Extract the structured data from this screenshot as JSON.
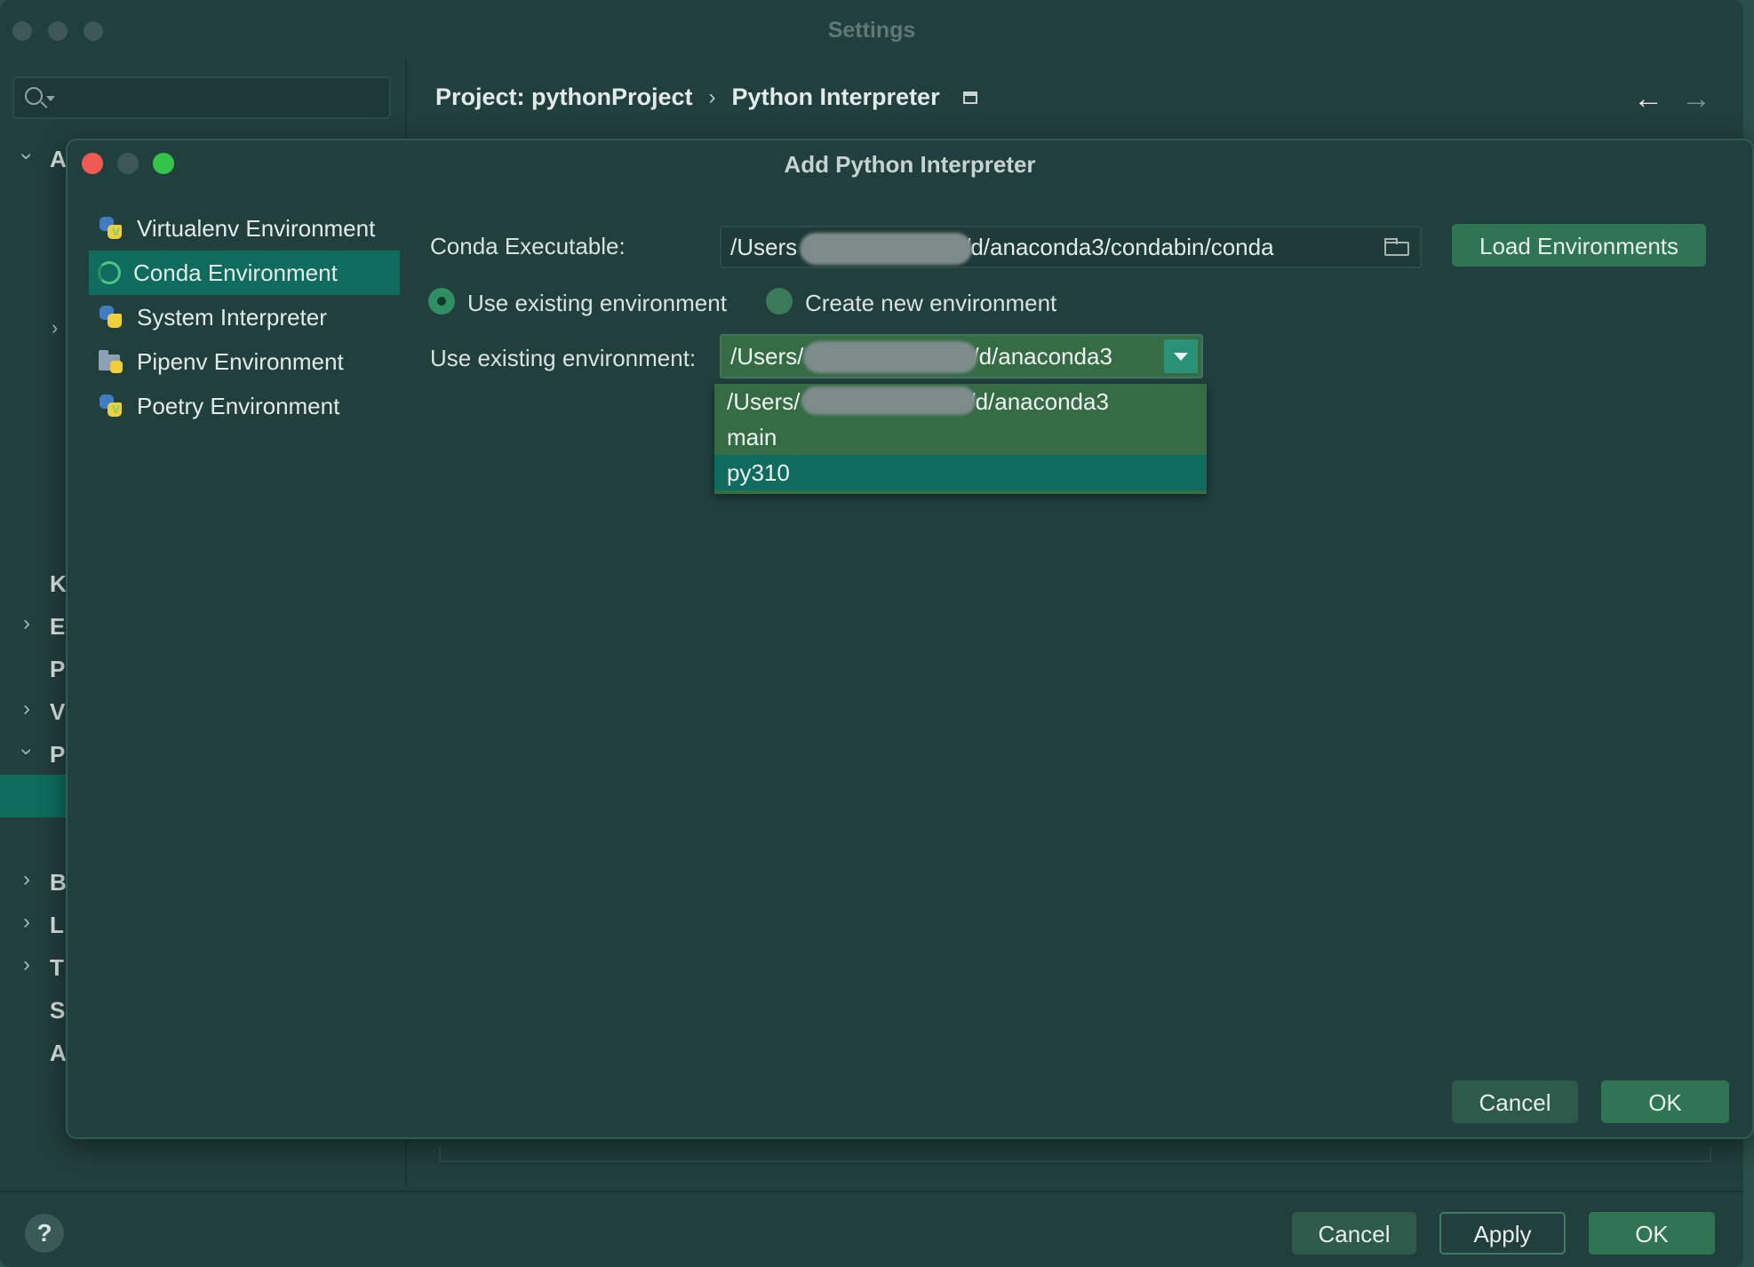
{
  "settings": {
    "title": "Settings",
    "breadcrumb": {
      "project": "Project: pythonProject",
      "separator": "›",
      "page": "Python Interpreter"
    },
    "nav_back": "←",
    "nav_forward": "→",
    "tree_letters": [
      "A",
      "K",
      "E",
      "P",
      "V",
      "P",
      "B",
      "L",
      "T",
      "S",
      "A"
    ],
    "buttons": {
      "help": "?",
      "cancel": "Cancel",
      "apply": "Apply",
      "ok": "OK"
    }
  },
  "dialog": {
    "title": "Add Python Interpreter",
    "environments": [
      {
        "label": "Virtualenv Environment",
        "icon": "python-virtualenv-icon"
      },
      {
        "label": "Conda Environment",
        "icon": "conda-icon",
        "selected": true
      },
      {
        "label": "System Interpreter",
        "icon": "python-icon"
      },
      {
        "label": "Pipenv Environment",
        "icon": "pipenv-folder-icon"
      },
      {
        "label": "Poetry Environment",
        "icon": "python-poetry-icon"
      }
    ],
    "conda_executable_label": "Conda Executable:",
    "conda_executable_prefix": "/Users",
    "conda_executable_suffix": "/d/anaconda3/condabin/conda",
    "load_environments": "Load Environments",
    "radio_use_existing": "Use existing environment",
    "radio_create_new": "Create new environment",
    "use_existing_label": "Use existing environment:",
    "combo_prefix": "/Users/",
    "combo_suffix": "/d/anaconda3",
    "dropdown_options": [
      {
        "prefix": "/Users/",
        "suffix": "/d/anaconda3"
      },
      {
        "label": "main"
      },
      {
        "label": "py310",
        "highlighted": true
      }
    ],
    "cancel": "Cancel",
    "ok": "OK"
  },
  "colors": {
    "background": "#213f3d",
    "selection": "#0e6b5e",
    "accent_green": "#2f7553",
    "dropdown": "#356c44"
  }
}
